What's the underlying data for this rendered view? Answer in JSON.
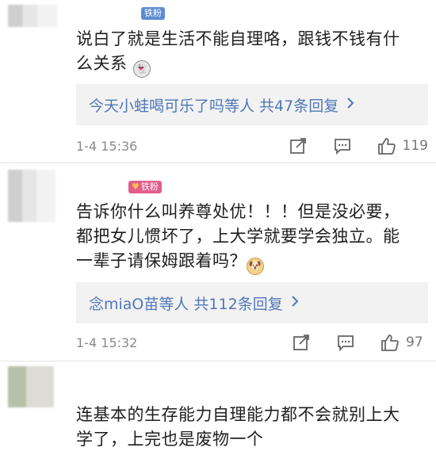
{
  "comments": [
    {
      "badge": "铁粉",
      "text_line1": "说白了就是生活不能自理咯，跟钱不钱有什",
      "text_line2": "么关系",
      "replies": "今天小蛙喝可乐了吗等人 共47条回复",
      "time": "1-4 15:36",
      "likes": "119"
    },
    {
      "badge": "铁粉",
      "text_line1": "告诉你什么叫养尊处优！！！但是没必要，",
      "text_line2": "都把女儿惯坏了，上大学就要学会独立。能",
      "text_line3": "一辈子请保姆跟着吗？",
      "replies": "念miaO苗等人 共112条回复",
      "time": "1-4 15:32",
      "likes": "97"
    },
    {
      "text_line1": "连基本的生存能力自理能力都不会就别上大",
      "text_line2": "学了，上完也是废物一个"
    }
  ],
  "icons": {
    "share": "share-icon",
    "comment": "comment-icon",
    "like": "thumbs-up-icon",
    "chevron": "chevron-right-icon"
  },
  "colors": {
    "link": "#4f78b8",
    "badge_blue": "#5c8cd1",
    "badge_pink": "#e35d8c",
    "meta": "#8a8a8a"
  }
}
